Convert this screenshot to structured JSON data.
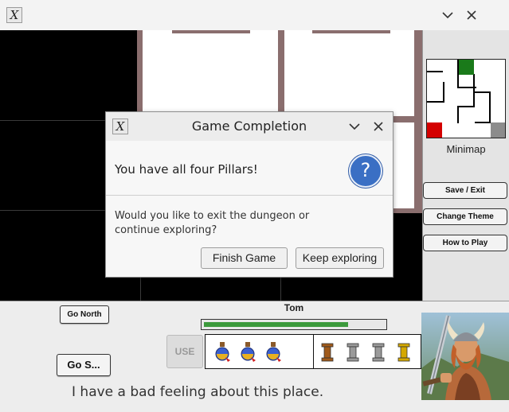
{
  "window": {
    "minimize_glyph": "⌵",
    "close_glyph": "✕"
  },
  "side_panel": {
    "minimap_label": "Minimap",
    "buttons": [
      {
        "label": "Save / Exit"
      },
      {
        "label": "Change Theme"
      },
      {
        "label": "How to Play"
      }
    ]
  },
  "minimap": {
    "colors": {
      "current": "#d40000",
      "pillar": "#1a7a1a",
      "exit": "#8c8c8c"
    }
  },
  "controls": {
    "go_north": "Go North",
    "go_south": "Go S...",
    "use": "USE"
  },
  "hero": {
    "name": "Tom",
    "health_fraction": 0.8
  },
  "inventory": {
    "potions": [
      "potion-icon",
      "potion-icon",
      "potion-icon"
    ],
    "pillars": [
      {
        "icon": "pillar-icon",
        "color": "#a05a1a"
      },
      {
        "icon": "pillar-icon",
        "color": "#9a9a9a"
      },
      {
        "icon": "pillar-icon",
        "color": "#9a9a9a"
      },
      {
        "icon": "pillar-icon",
        "color": "#d4a800"
      }
    ]
  },
  "message": "I have a bad feeling about this place.",
  "dialog": {
    "title": "Game Completion",
    "heading": "You have all four Pillars!",
    "body": "Would you like to exit the dungeon or continue exploring?",
    "finish_label": "Finish Game",
    "continue_label": "Keep exploring",
    "question_glyph": "?"
  }
}
